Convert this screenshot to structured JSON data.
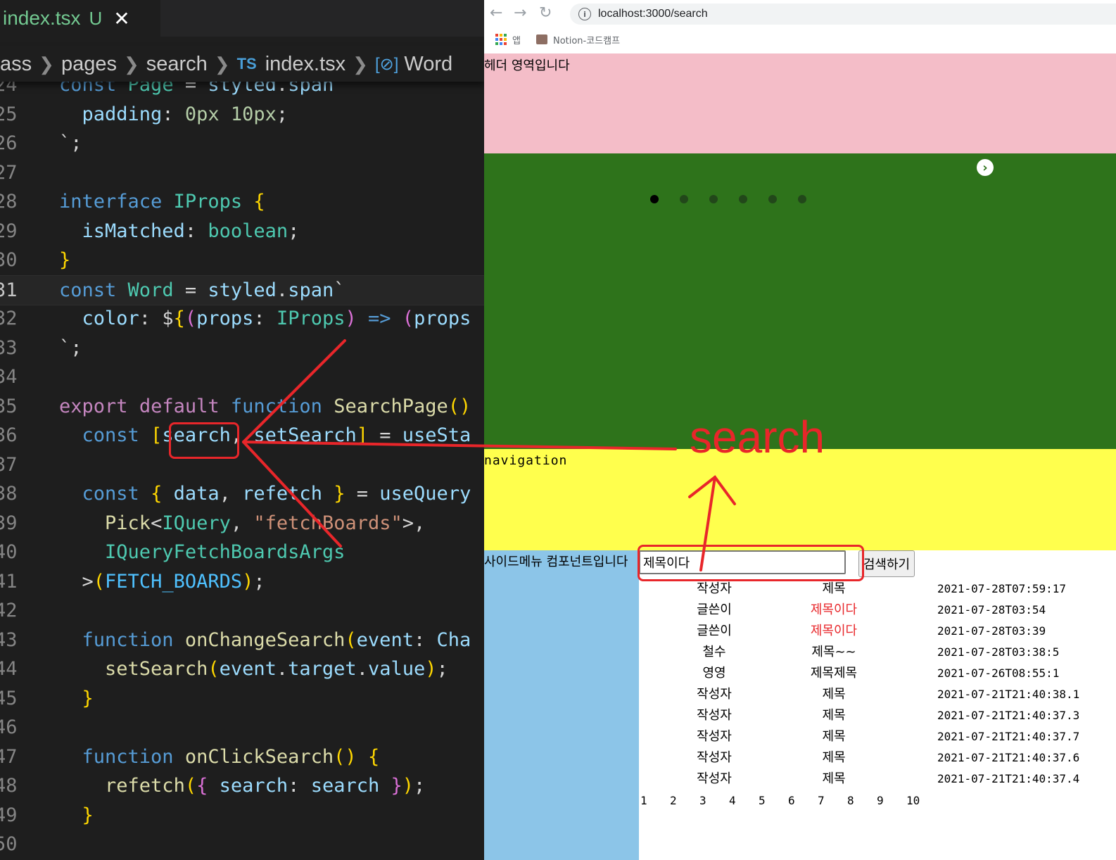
{
  "editor": {
    "tab": {
      "filename": "index.tsx",
      "status": "U",
      "close": "✕"
    },
    "breadcrumb": [
      "ass",
      "pages",
      "search",
      "index.tsx",
      "Word"
    ],
    "breadcrumb_ts_badge": "TS",
    "lines": [
      {
        "n": "24",
        "code": "const Page = styled.span"
      },
      {
        "n": "25",
        "code": "  padding: 0px 10px;"
      },
      {
        "n": "26",
        "code": "`;"
      },
      {
        "n": "27",
        "code": ""
      },
      {
        "n": "28",
        "code": "interface IProps {"
      },
      {
        "n": "29",
        "code": "  isMatched: boolean;"
      },
      {
        "n": "30",
        "code": "}"
      },
      {
        "n": "31",
        "code": "const Word = styled.span`"
      },
      {
        "n": "32",
        "code": "  color: ${(props: IProps) => (props"
      },
      {
        "n": "33",
        "code": "`;"
      },
      {
        "n": "34",
        "code": ""
      },
      {
        "n": "35",
        "code": "export default function SearchPage()"
      },
      {
        "n": "36",
        "code": "  const [search, setSearch] = useSta"
      },
      {
        "n": "37",
        "code": ""
      },
      {
        "n": "38",
        "code": "  const { data, refetch } = useQuery"
      },
      {
        "n": "39",
        "code": "    Pick<IQuery, \"fetchBoards\">,"
      },
      {
        "n": "40",
        "code": "    IQueryFetchBoardsArgs"
      },
      {
        "n": "41",
        "code": "  >(FETCH_BOARDS);"
      },
      {
        "n": "42",
        "code": ""
      },
      {
        "n": "43",
        "code": "  function onChangeSearch(event: Cha"
      },
      {
        "n": "44",
        "code": "    setSearch(event.target.value);"
      },
      {
        "n": "45",
        "code": "  }"
      },
      {
        "n": "46",
        "code": ""
      },
      {
        "n": "47",
        "code": "  function onClickSearch() {"
      },
      {
        "n": "48",
        "code": "    refetch({ search: search });"
      },
      {
        "n": "49",
        "code": "  }"
      },
      {
        "n": "50",
        "code": ""
      }
    ]
  },
  "browser": {
    "url": "localhost:3000/search",
    "bookmarks": {
      "apps": "앱",
      "notion": "Notion-코드캠프"
    },
    "header_text": "헤더 영역입니다",
    "carousel_next": "›",
    "navigation_text": "navigation",
    "sidebar_text": "사이드메뉴 컴포넌트입니다",
    "search": {
      "value": "제목이다",
      "button": "검색하기"
    },
    "boards": [
      {
        "writer": "작성자",
        "title": "제목",
        "date": "2021-07-28T07:59:17",
        "match": false
      },
      {
        "writer": "글쓴이",
        "title": "제목이다",
        "date": "2021-07-28T03:54",
        "match": true
      },
      {
        "writer": "글쓴이",
        "title": "제목이다",
        "date": "2021-07-28T03:39",
        "match": true
      },
      {
        "writer": "철수",
        "title": "제목~~",
        "date": "2021-07-28T03:38:5",
        "match": false
      },
      {
        "writer": "영영",
        "title": "제목제목",
        "date": "2021-07-26T08:55:1",
        "match": false
      },
      {
        "writer": "작성자",
        "title": "제목",
        "date": "2021-07-21T21:40:38.1",
        "match": false
      },
      {
        "writer": "작성자",
        "title": "제목",
        "date": "2021-07-21T21:40:37.3",
        "match": false
      },
      {
        "writer": "작성자",
        "title": "제목",
        "date": "2021-07-21T21:40:37.7",
        "match": false
      },
      {
        "writer": "작성자",
        "title": "제목",
        "date": "2021-07-21T21:40:37.6",
        "match": false
      },
      {
        "writer": "작성자",
        "title": "제목",
        "date": "2021-07-21T21:40:37.4",
        "match": false
      }
    ],
    "pages": [
      "1",
      "2",
      "3",
      "4",
      "5",
      "6",
      "7",
      "8",
      "9",
      "10"
    ]
  },
  "annotation": {
    "label": "search",
    "color": "#e8262a"
  },
  "colors": {
    "header": "#f4bdc8",
    "banner": "#2e731b",
    "navigation": "#ffff4d",
    "sidebar": "#8cc5e8",
    "match": "#e8262a"
  }
}
